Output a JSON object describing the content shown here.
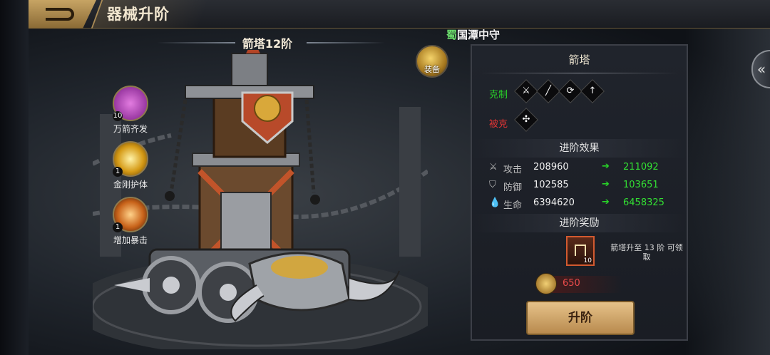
{
  "header": {
    "title": "器械升阶"
  },
  "location": {
    "prefix": "蜀",
    "name": "国潭中守"
  },
  "unit": {
    "title": "箭塔12阶"
  },
  "equip": {
    "label": "装备"
  },
  "skills": [
    {
      "name": "万箭齐发",
      "level": "10"
    },
    {
      "name": "金刚护体",
      "level": "1"
    },
    {
      "name": "增加暴击",
      "level": "1"
    }
  ],
  "panel": {
    "title": "箭塔",
    "counter_label": "克制",
    "countered_label": "被克",
    "advance_effect_label": "进阶效果",
    "stats": [
      {
        "name": "攻击",
        "old": "208960",
        "new": "211092"
      },
      {
        "name": "防御",
        "old": "102585",
        "new": "103651"
      },
      {
        "name": "生命",
        "old": "6394620",
        "new": "6458325"
      }
    ],
    "advance_reward_label": "进阶奖励",
    "reward_count": "10",
    "reward_text": "箭塔升至 13 阶 可领取",
    "cost": "650",
    "upgrade_label": "升阶"
  }
}
